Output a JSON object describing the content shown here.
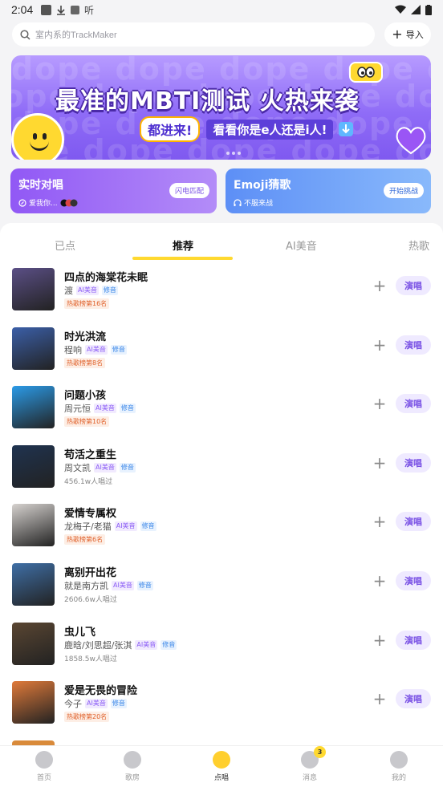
{
  "status": {
    "time": "2:04"
  },
  "search": {
    "placeholder": "室内系的TrackMaker"
  },
  "import_label": "导入",
  "banner": {
    "title": "最准的MBTI测试 火热来袭",
    "highlight": "都进来!",
    "subtitle": "看看你是e人还是i人!",
    "bg_text": "dope dope dope dope dope dope dope"
  },
  "cards": [
    {
      "title": "实时对唱",
      "sub": "爱我你...",
      "button": "闪电匹配"
    },
    {
      "title": "Emoji猜歌",
      "sub": "不服来战",
      "button": "开始挑战"
    }
  ],
  "tabs": [
    "已点",
    "推荐",
    "AI美音",
    "热歌"
  ],
  "active_tab": "推荐",
  "sing_label": "演唱",
  "tags": {
    "ai": "AI美音",
    "fix": "修音"
  },
  "songs": [
    {
      "title": "四点的海棠花未眠",
      "artist": "渡",
      "extra": "热歌榜第16名",
      "extra_type": "rank",
      "cover": "#5b4f86"
    },
    {
      "title": "时光洪流",
      "artist": "程响",
      "extra": "热歌榜第8名",
      "extra_type": "rank",
      "cover": "#3b5fa8"
    },
    {
      "title": "问题小孩",
      "artist": "周元恒",
      "extra": "热歌榜第10名",
      "extra_type": "rank",
      "cover": "#2b9be8"
    },
    {
      "title": "苟活之重生",
      "artist": "周文凯",
      "extra": "456.1w人唱过",
      "extra_type": "plays",
      "cover": "#1f3350"
    },
    {
      "title": "爱情专属权",
      "artist": "龙梅子/老猫",
      "extra": "热歌榜第6名",
      "extra_type": "rank",
      "cover": "#d6d2cf"
    },
    {
      "title": "离别开出花",
      "artist": "就是南方凯",
      "extra": "2606.6w人唱过",
      "extra_type": "plays",
      "cover": "#3f6fa6"
    },
    {
      "title": "虫儿飞",
      "artist": "鹿晗/刘思超/张淇",
      "extra": "1858.5w人唱过",
      "extra_type": "plays",
      "cover": "#5a4632"
    },
    {
      "title": "爱是无畏的冒险",
      "artist": "今子",
      "extra": "热歌榜第20名",
      "extra_type": "rank",
      "cover": "#e07a3a"
    }
  ],
  "nav": [
    {
      "label": "首页",
      "icon": "home-icon"
    },
    {
      "label": "歌房",
      "icon": "room-icon"
    },
    {
      "label": "点唱",
      "icon": "sing-icon",
      "active": true
    },
    {
      "label": "消息",
      "icon": "message-icon",
      "badge": "3"
    },
    {
      "label": "我的",
      "icon": "profile-icon"
    }
  ],
  "colors": {
    "accent": "#7a52e5",
    "yellow": "#ffd930",
    "rank": "#e0612b"
  }
}
